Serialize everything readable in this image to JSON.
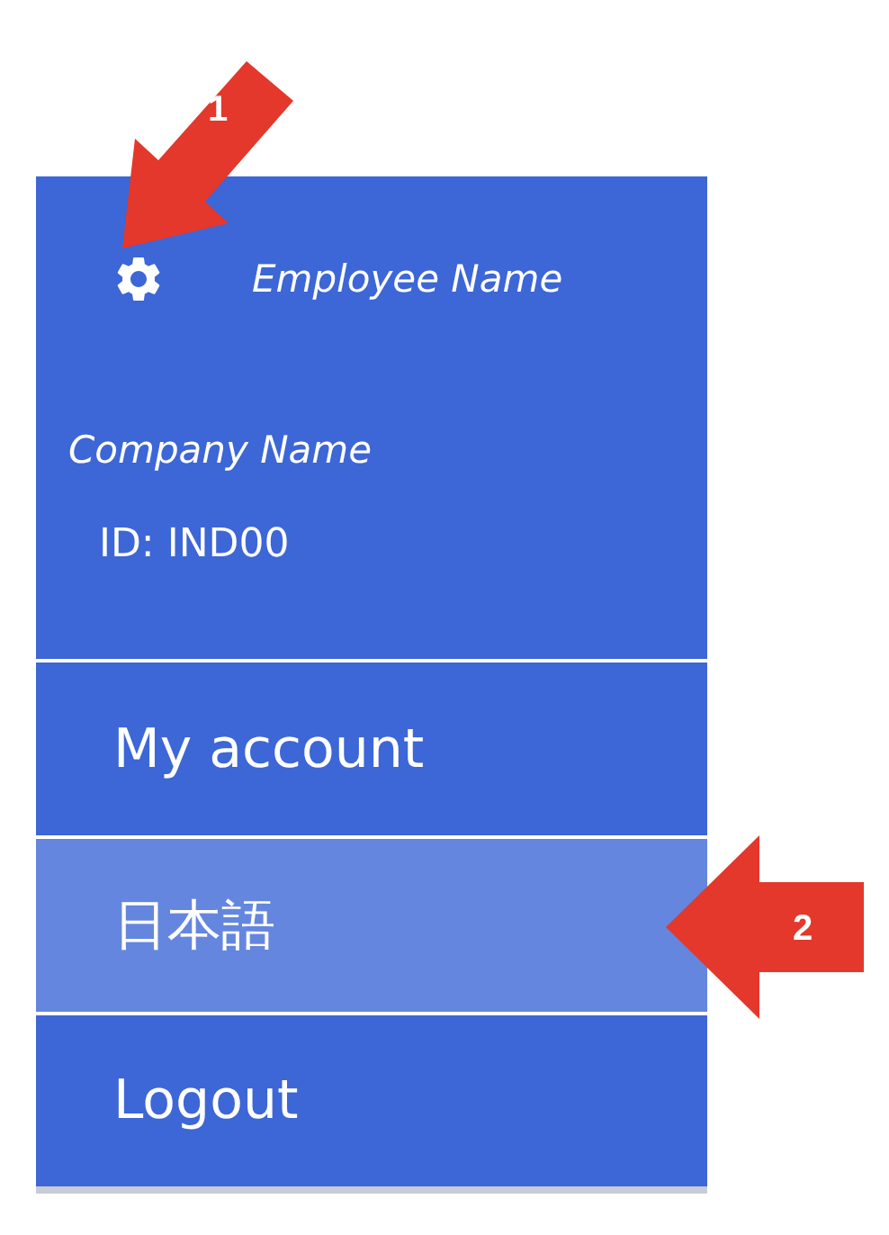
{
  "header": {
    "employee_name": "Employee Name",
    "company_name": "Company Name",
    "id": "ID: IND00"
  },
  "menu": [
    {
      "label": "My account",
      "selected": false
    },
    {
      "label": "日本語",
      "selected": true
    },
    {
      "label": "Logout",
      "selected": false
    }
  ],
  "annotations": [
    {
      "label": "1",
      "kind": "diagonal"
    },
    {
      "label": "2",
      "kind": "left"
    }
  ]
}
